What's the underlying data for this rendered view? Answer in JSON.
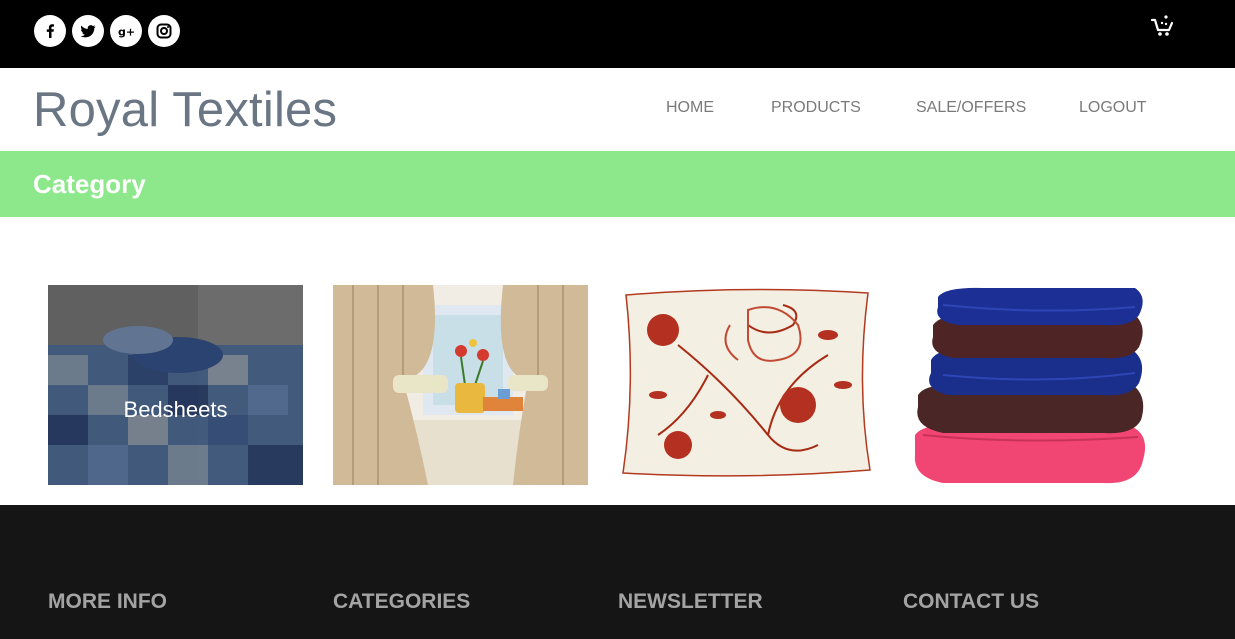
{
  "brand": {
    "name": "Royal Textiles"
  },
  "social": [
    "facebook-icon",
    "twitter-icon",
    "google-plus-icon",
    "instagram-icon"
  ],
  "nav": {
    "home": "HOME",
    "products": "PRODUCTS",
    "sale": "SALE/OFFERS",
    "logout": "LOGOUT"
  },
  "category": {
    "title": "Category"
  },
  "tiles": [
    {
      "label": "Bedsheets"
    },
    {
      "label": ""
    },
    {
      "label": ""
    },
    {
      "label": ""
    }
  ],
  "footer": {
    "more_info": "MORE INFO",
    "categories": "CATEGORIES",
    "newsletter": "NEWSLETTER",
    "contact": "CONTACT US"
  },
  "colors": {
    "topbar": "#000000",
    "category_bar": "#8de88b",
    "footer": "#151515",
    "brand_text": "#6b7685"
  }
}
